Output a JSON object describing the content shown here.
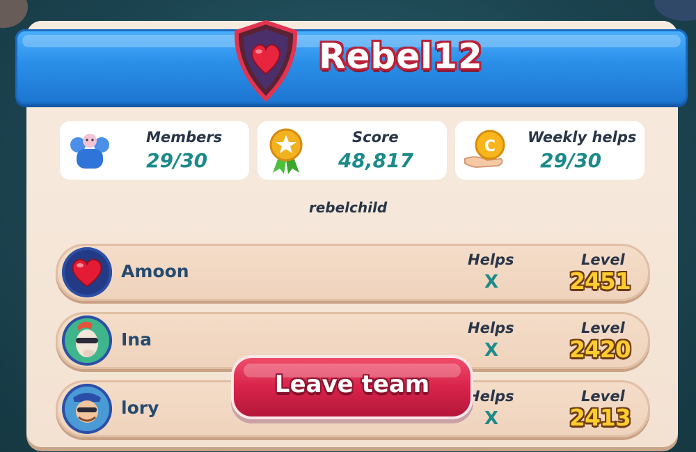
{
  "team": {
    "name": "Rebel12",
    "description": "rebelchild"
  },
  "stats": {
    "members_label": "Members",
    "members_value": "29/30",
    "score_label": "Score",
    "score_value": "48,817",
    "weekly_label": "Weekly helps",
    "weekly_value": "29/30"
  },
  "members": [
    {
      "name": "Amoon",
      "helps_label": "Helps",
      "helps_value": "X",
      "level_label": "Level",
      "level_value": "2451",
      "avatar": "heart-avatar"
    },
    {
      "name": "Ina",
      "helps_label": "Helps",
      "helps_value": "X",
      "level_label": "Level",
      "level_value": "2420",
      "avatar": "character-avatar"
    },
    {
      "name": "lory",
      "helps_label": "Helps",
      "helps_value": "X",
      "level_label": "Level",
      "level_value": "2413",
      "avatar": "character-avatar"
    }
  ],
  "actions": {
    "leave_label": "Leave team"
  },
  "colors": {
    "banner": "#2a8fe8",
    "accent_teal": "#1d8a8a",
    "leave_button": "#d8234a",
    "level_gold": "#ffcc2e"
  }
}
